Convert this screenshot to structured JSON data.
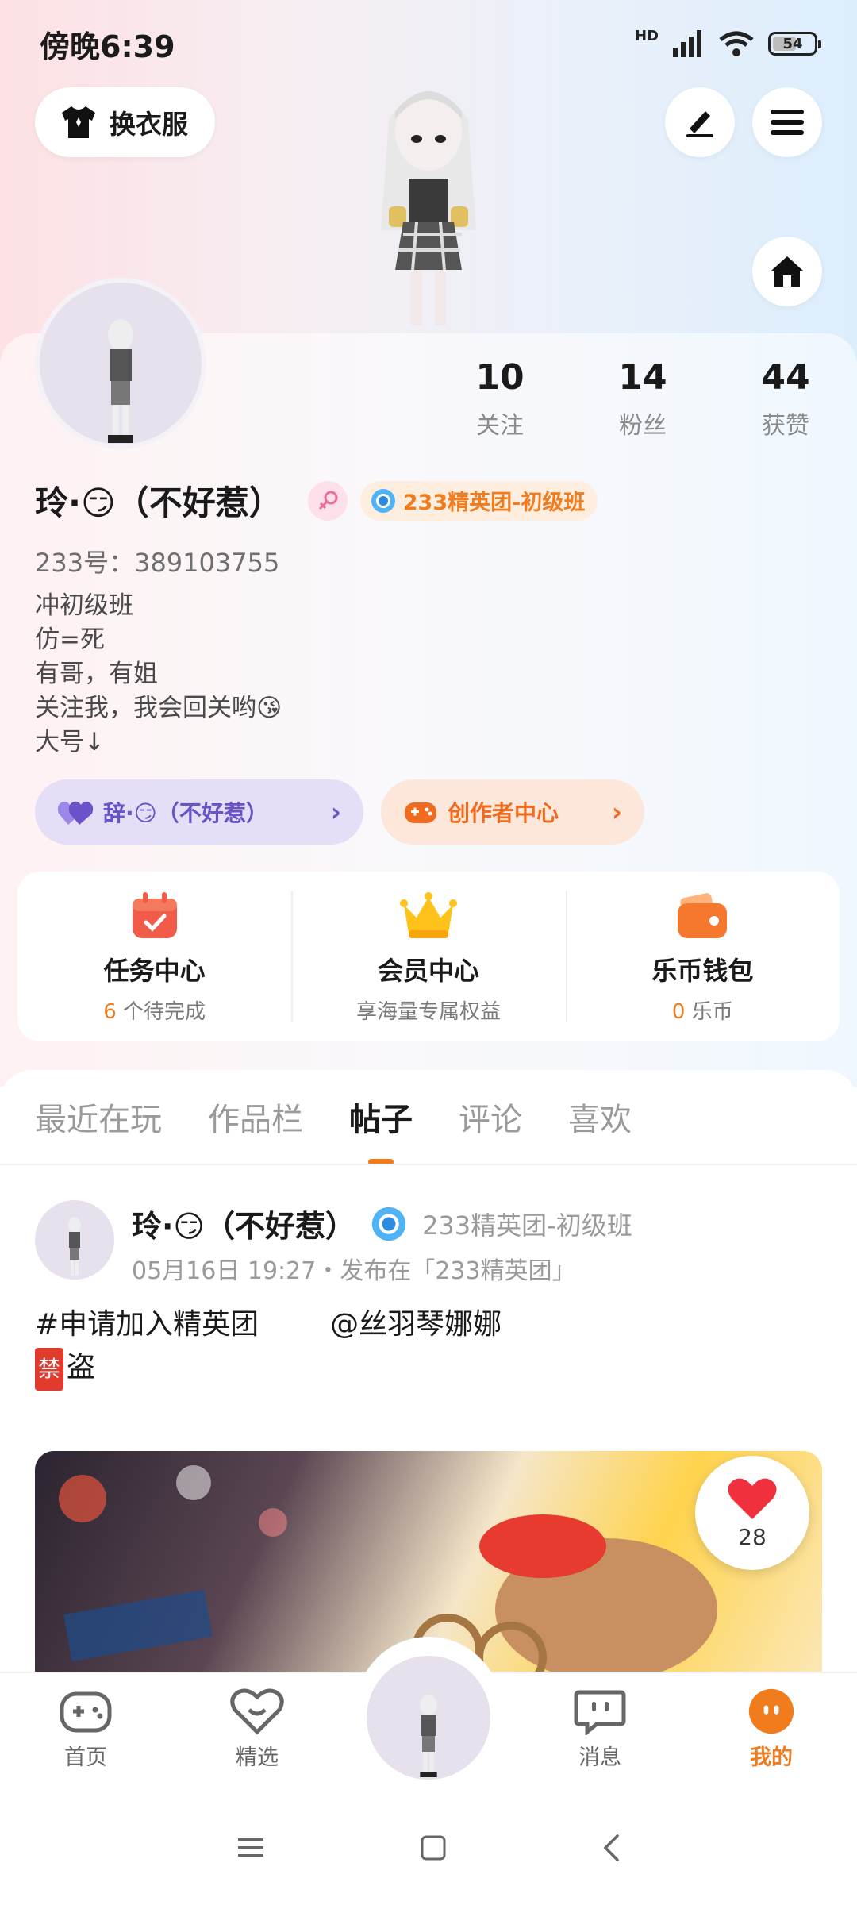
{
  "status_bar": {
    "time": "傍晚6:39",
    "hd": "HD",
    "battery": "54"
  },
  "header": {
    "outfit_button_label": "换衣服",
    "edit_icon": "pen-icon",
    "menu_icon": "hamburger-menu-icon",
    "home_icon": "home-icon"
  },
  "profile": {
    "stats": [
      {
        "value": "10",
        "label": "关注"
      },
      {
        "value": "14",
        "label": "粉丝"
      },
      {
        "value": "44",
        "label": "获赞"
      }
    ],
    "name": "玲·😏（不好惹）",
    "club_badge": "233精英团-初级班",
    "uid": "233号：389103755",
    "bio": [
      "冲初级班",
      "仿=死",
      "有哥，有姐",
      "关注我，我会回关哟😘",
      "大号↓"
    ],
    "linked_account_label": "辞·😏（不好惹）",
    "creator_center_label": "创作者中心"
  },
  "features": [
    {
      "title": "任务中心",
      "sub_count": "6",
      "sub_text": " 个待完成",
      "icon": "calendar-check-icon"
    },
    {
      "title": "会员中心",
      "sub_count": "",
      "sub_text": "享海量专属权益",
      "icon": "crown-icon"
    },
    {
      "title": "乐币钱包",
      "sub_count": "0",
      "sub_text": " 乐币",
      "icon": "wallet-icon"
    }
  ],
  "tabs": [
    "最近在玩",
    "作品栏",
    "帖子",
    "评论",
    "喜欢"
  ],
  "active_tab": "帖子",
  "post": {
    "author": "玲·😏（不好惹）",
    "club": "233精英团-初级班",
    "meta": "05月16日 19:27・发布在「233精英团」",
    "line1_a": "#申请加入精英团",
    "line1_b": "@丝羽琴娜娜",
    "ban_char": "禁",
    "line2_rest": "盗",
    "likes": "28"
  },
  "bottom_nav": [
    {
      "label": "首页",
      "icon": "gamepad-icon"
    },
    {
      "label": "精选",
      "icon": "heart-face-icon"
    },
    {
      "label": "消息",
      "icon": "chat-icon"
    },
    {
      "label": "我的",
      "icon": "profile-face-icon"
    }
  ],
  "colors": {
    "accent": "#f07c1e",
    "purple": "#6b52c8",
    "like_red": "#f0303d"
  }
}
